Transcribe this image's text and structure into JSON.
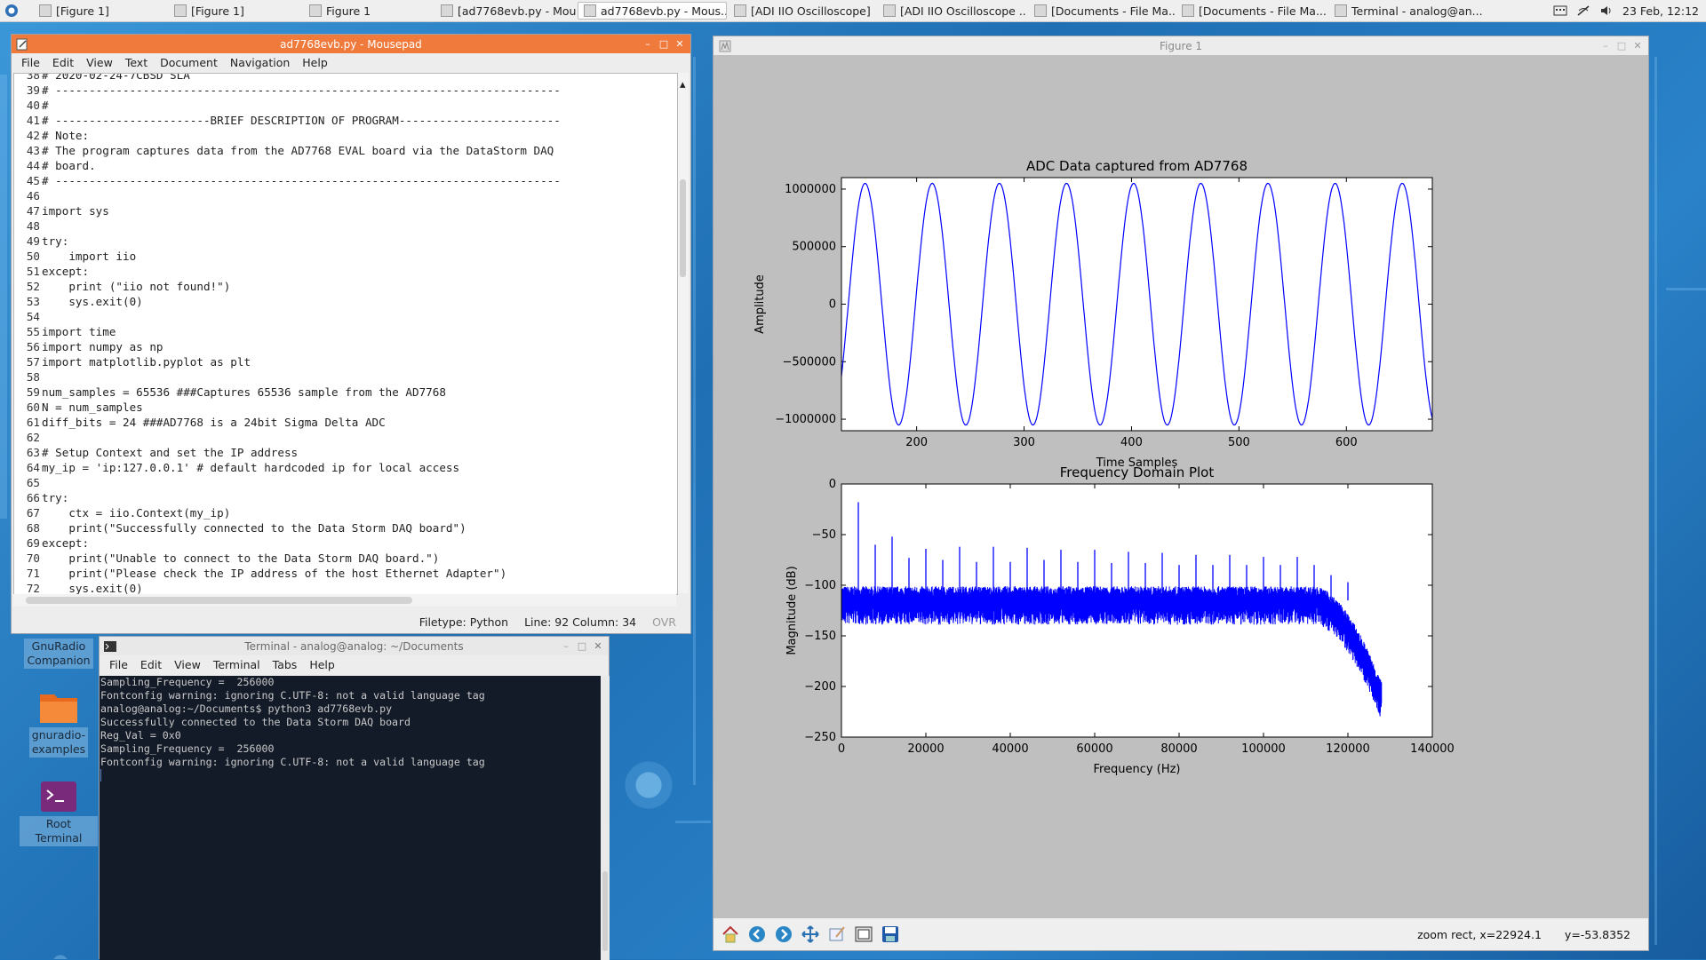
{
  "taskbar": {
    "tasks": [
      {
        "label": "[Figure 1]",
        "active": false
      },
      {
        "label": "[Figure 1]",
        "active": false
      },
      {
        "label": "Figure 1",
        "active": false
      },
      {
        "label": "[ad7768evb.py - Mou...",
        "active": false
      },
      {
        "label": "ad7768evb.py - Mous...",
        "active": true
      },
      {
        "label": "[ADI IIO Oscilloscope]",
        "active": false
      },
      {
        "label": "[ADI IIO Oscilloscope ...",
        "active": false
      },
      {
        "label": "[Documents - File Ma...",
        "active": false
      },
      {
        "label": "[Documents - File Ma...",
        "active": false
      },
      {
        "label": "Terminal - analog@an...",
        "active": false
      }
    ],
    "clock": "23 Feb, 12:12"
  },
  "mousepad": {
    "title": "ad7768evb.py - Mousepad",
    "menu": [
      "File",
      "Edit",
      "View",
      "Text",
      "Document",
      "Navigation",
      "Help"
    ],
    "lines": [
      {
        "n": "38",
        "t": "# 2020-02-24-7CBSD SLA"
      },
      {
        "n": "39",
        "t": "# ---------------------------------------------------------------------------"
      },
      {
        "n": "40",
        "t": "#"
      },
      {
        "n": "41",
        "t": "# -----------------------BRIEF DESCRIPTION OF PROGRAM------------------------"
      },
      {
        "n": "42",
        "t": "# Note:"
      },
      {
        "n": "43",
        "t": "# The program captures data from the AD7768 EVAL board via the DataStorm DAQ"
      },
      {
        "n": "44",
        "t": "# board."
      },
      {
        "n": "45",
        "t": "# ---------------------------------------------------------------------------"
      },
      {
        "n": "46",
        "t": ""
      },
      {
        "n": "47",
        "t": "import sys"
      },
      {
        "n": "48",
        "t": ""
      },
      {
        "n": "49",
        "t": "try:"
      },
      {
        "n": "50",
        "t": "    import iio"
      },
      {
        "n": "51",
        "t": "except:"
      },
      {
        "n": "52",
        "t": "    print (\"iio not found!\")"
      },
      {
        "n": "53",
        "t": "    sys.exit(0)"
      },
      {
        "n": "54",
        "t": ""
      },
      {
        "n": "55",
        "t": "import time"
      },
      {
        "n": "56",
        "t": "import numpy as np"
      },
      {
        "n": "57",
        "t": "import matplotlib.pyplot as plt"
      },
      {
        "n": "58",
        "t": ""
      },
      {
        "n": "59",
        "t": "num_samples = 65536 ###Captures 65536 sample from the AD7768"
      },
      {
        "n": "60",
        "t": "N = num_samples"
      },
      {
        "n": "61",
        "t": "diff_bits = 24 ###AD7768 is a 24bit Sigma Delta ADC"
      },
      {
        "n": "62",
        "t": ""
      },
      {
        "n": "63",
        "t": "# Setup Context and set the IP address"
      },
      {
        "n": "64",
        "t": "my_ip = 'ip:127.0.0.1' # default hardcoded ip for local access"
      },
      {
        "n": "65",
        "t": ""
      },
      {
        "n": "66",
        "t": "try:"
      },
      {
        "n": "67",
        "t": "    ctx = iio.Context(my_ip)"
      },
      {
        "n": "68",
        "t": "    print(\"Successfully connected to the Data Storm DAQ board\")"
      },
      {
        "n": "69",
        "t": "except:"
      },
      {
        "n": "70",
        "t": "    print(\"Unable to connect to the Data Storm DAQ board.\")"
      },
      {
        "n": "71",
        "t": "    print(\"Please check the IP address of the host Ethernet Adapter\")"
      },
      {
        "n": "72",
        "t": "    sys.exit(0)"
      }
    ],
    "status": {
      "filetype": "Filetype: Python",
      "position": "Line: 92 Column: 34",
      "mode": "OVR"
    }
  },
  "terminal": {
    "title": "Terminal - analog@analog: ~/Documents",
    "menu": [
      "File",
      "Edit",
      "View",
      "Terminal",
      "Tabs",
      "Help"
    ],
    "lines": [
      "Sampling_Frequency =  256000",
      "Fontconfig warning: ignoring C.UTF-8: not a valid language tag",
      "analog@analog:~/Documents$ python3 ad7768evb.py",
      "Successfully connected to the Data Storm DAQ board",
      "Reg_Val = 0x0",
      "Sampling_Frequency =  256000",
      "Fontconfig warning: ignoring C.UTF-8: not a valid language tag"
    ]
  },
  "desktop_icons": [
    {
      "label": "GnuRadio\nCompanion"
    },
    {
      "label": "gnuradio-\nexamples"
    },
    {
      "label": "Root Terminal"
    }
  ],
  "figure": {
    "title": "Figure 1",
    "status_left": "zoom rect, x=22924.1",
    "status_right": "y=-53.8352"
  },
  "colors": {
    "accent": "#ef7a3c",
    "plot_line": "#0000ff",
    "terminal_bg": "#131a28"
  },
  "chart_data": [
    {
      "type": "line",
      "title": "ADC Data captured from AD7768",
      "xlabel": "Time Samples",
      "ylabel": "Amplitude",
      "xlim": [
        130,
        680
      ],
      "ylim": [
        -1100000,
        1100000
      ],
      "xticks": [
        200,
        300,
        400,
        500,
        600
      ],
      "yticks": [
        1000000,
        500000,
        0,
        -500000,
        -1000000
      ],
      "ytick_labels": [
        "1000000",
        "500000",
        "0",
        "−500000",
        "−1000000"
      ],
      "series": [
        {
          "amplitude": 1050000,
          "period_samples": 62.5,
          "first_peak_x": 152
        }
      ]
    },
    {
      "type": "line",
      "title": "Frequency Domain Plot",
      "xlabel": "Frequency (Hz)",
      "ylabel": "Magnitude (dB)",
      "xlim": [
        0,
        140000
      ],
      "ylim": [
        -250,
        0
      ],
      "xticks": [
        0,
        20000,
        40000,
        60000,
        80000,
        100000,
        120000,
        140000
      ],
      "yticks": [
        0,
        -50,
        -100,
        -150,
        -200,
        -250
      ],
      "ytick_labels": [
        "0",
        "−50",
        "−100",
        "−150",
        "−200",
        "−250"
      ],
      "noise_floor_db": -115,
      "rolloff_start_hz": 112000,
      "end_hz": 128000,
      "end_db": -210,
      "peaks": [
        {
          "x": 4000,
          "y": -18
        },
        {
          "x": 8000,
          "y": -60
        },
        {
          "x": 12000,
          "y": -52
        },
        {
          "x": 16000,
          "y": -73
        },
        {
          "x": 20000,
          "y": -64
        },
        {
          "x": 24000,
          "y": -75
        },
        {
          "x": 28000,
          "y": -62
        },
        {
          "x": 32000,
          "y": -77
        },
        {
          "x": 36000,
          "y": -62
        },
        {
          "x": 40000,
          "y": -77
        },
        {
          "x": 44000,
          "y": -63
        },
        {
          "x": 48000,
          "y": -75
        },
        {
          "x": 52000,
          "y": -65
        },
        {
          "x": 56000,
          "y": -77
        },
        {
          "x": 60000,
          "y": -65
        },
        {
          "x": 64000,
          "y": -78
        },
        {
          "x": 68000,
          "y": -67
        },
        {
          "x": 72000,
          "y": -78
        },
        {
          "x": 76000,
          "y": -68
        },
        {
          "x": 80000,
          "y": -80
        },
        {
          "x": 84000,
          "y": -70
        },
        {
          "x": 88000,
          "y": -80
        },
        {
          "x": 92000,
          "y": -70
        },
        {
          "x": 96000,
          "y": -80
        },
        {
          "x": 100000,
          "y": -72
        },
        {
          "x": 104000,
          "y": -80
        },
        {
          "x": 108000,
          "y": -72
        },
        {
          "x": 112000,
          "y": -80
        },
        {
          "x": 116000,
          "y": -90
        },
        {
          "x": 120000,
          "y": -97
        }
      ]
    }
  ]
}
